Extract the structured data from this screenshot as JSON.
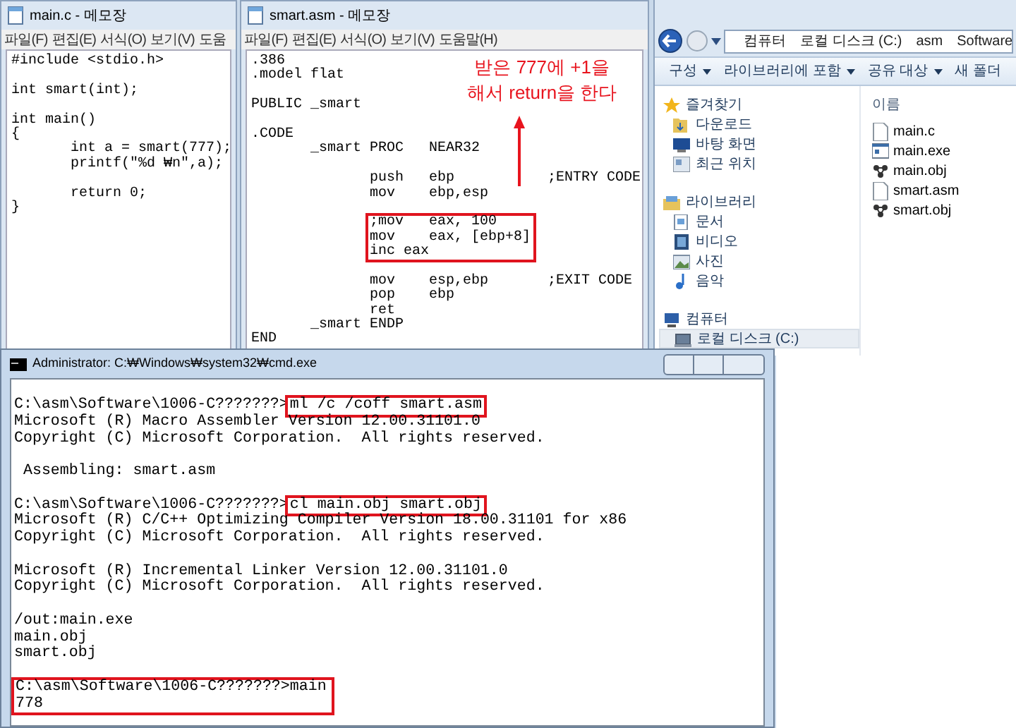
{
  "notepad_main": {
    "title": "main.c - 메모장",
    "menu": [
      "파일(F)",
      "편집(E)",
      "서식(O)",
      "보기(V)",
      "도움"
    ],
    "blocks": [
      [
        "#include <stdio.h>"
      ],
      [
        "int smart(int);"
      ],
      [
        "int main()",
        "{",
        "       int a = smart(777);",
        "       printf(\"%d ₩n\",a);"
      ],
      [
        "       return 0;",
        "}"
      ]
    ]
  },
  "notepad_asm": {
    "title": "smart.asm - 메모장",
    "menu": [
      "파일(F)",
      "편집(E)",
      "서식(O)",
      "보기(V)",
      "도움말(H)"
    ],
    "blocks": [
      {
        "boxed": false,
        "lines": [
          ".386",
          ".model flat"
        ]
      },
      {
        "boxed": false,
        "lines": [
          "PUBLIC _smart"
        ]
      },
      {
        "boxed": false,
        "lines": [
          ".CODE",
          "       _smart PROC   NEAR32"
        ]
      },
      {
        "boxed": false,
        "lines": [
          "              push   ebp           ;ENTRY CODE",
          "              mov    ebp,esp"
        ]
      },
      {
        "boxed": true,
        "lines": [
          ";mov   eax, 100",
          "mov    eax, [ebp+8]",
          "inc eax"
        ]
      },
      {
        "boxed": false,
        "lines": [
          "              mov    esp,ebp       ;EXIT CODE",
          "              pop    ebp",
          "              ret",
          "       _smart ENDP",
          "END"
        ]
      }
    ],
    "annotation": [
      "받은 777에 +1을",
      "해서 return을 한다"
    ]
  },
  "explorer": {
    "breadcrumb": [
      "컴퓨터",
      "로컬 디스크 (C:)",
      "asm",
      "Software"
    ],
    "toolbar": [
      {
        "label": "구성",
        "dropdown": true
      },
      {
        "label": "라이브러리에 포함",
        "dropdown": true
      },
      {
        "label": "공유 대상",
        "dropdown": true
      },
      {
        "label": "새 폴더",
        "dropdown": false
      }
    ],
    "sidebar": [
      {
        "label": "즐겨찾기",
        "selected": false,
        "children": [
          {
            "label": "다운로드",
            "selected": false
          },
          {
            "label": "바탕 화면",
            "selected": false
          },
          {
            "label": "최근 위치",
            "selected": false
          }
        ]
      },
      {
        "label": "라이브러리",
        "selected": false,
        "children": [
          {
            "label": "문서",
            "selected": false
          },
          {
            "label": "비디오",
            "selected": false
          },
          {
            "label": "사진",
            "selected": false
          },
          {
            "label": "음악",
            "selected": false
          }
        ]
      },
      {
        "label": "컴퓨터",
        "selected": false,
        "children": [
          {
            "label": "로컬 디스크 (C:)",
            "selected": true
          }
        ]
      }
    ],
    "column_header": "이름",
    "files": [
      {
        "name": "main.c",
        "kind": "text"
      },
      {
        "name": "main.exe",
        "kind": "exe"
      },
      {
        "name": "main.obj",
        "kind": "obj"
      },
      {
        "name": "smart.asm",
        "kind": "text"
      },
      {
        "name": "smart.obj",
        "kind": "obj"
      }
    ]
  },
  "console": {
    "title": "Administrator: C:₩Windows₩system32₩cmd.exe",
    "blocks": [
      {
        "boxed": false,
        "lines": [
          {
            "kind": "prompt",
            "prompt": "C:\\asm\\Software\\1006-C???????>",
            "command": "ml /c /coff smart.asm",
            "command_boxed": true
          },
          {
            "kind": "output",
            "text": "Microsoft (R) Macro Assembler Version 12.00.31101.0"
          },
          {
            "kind": "output",
            "text": "Copyright (C) Microsoft Corporation.  All rights reserved."
          }
        ]
      },
      {
        "boxed": false,
        "lines": [
          {
            "kind": "output",
            "text": " Assembling: smart.asm"
          }
        ]
      },
      {
        "boxed": false,
        "lines": [
          {
            "kind": "prompt",
            "prompt": "C:\\asm\\Software\\1006-C???????>",
            "command": "cl main.obj smart.obj",
            "command_boxed": true
          },
          {
            "kind": "output",
            "text": "Microsoft (R) C/C++ Optimizing Compiler Version 18.00.31101 for x86"
          },
          {
            "kind": "output",
            "text": "Copyright (C) Microsoft Corporation.  All rights reserved."
          }
        ]
      },
      {
        "boxed": false,
        "lines": [
          {
            "kind": "output",
            "text": "Microsoft (R) Incremental Linker Version 12.00.31101.0"
          },
          {
            "kind": "output",
            "text": "Copyright (C) Microsoft Corporation.  All rights reserved."
          }
        ]
      },
      {
        "boxed": false,
        "lines": [
          {
            "kind": "output",
            "text": "/out:main.exe"
          },
          {
            "kind": "output",
            "text": "main.obj"
          },
          {
            "kind": "output",
            "text": "smart.obj"
          }
        ]
      },
      {
        "boxed": true,
        "lines": [
          {
            "kind": "prompt",
            "prompt": "C:\\asm\\Software\\1006-C???????>",
            "command": "main",
            "command_boxed": false
          },
          {
            "kind": "output",
            "text": "778"
          }
        ]
      }
    ]
  }
}
